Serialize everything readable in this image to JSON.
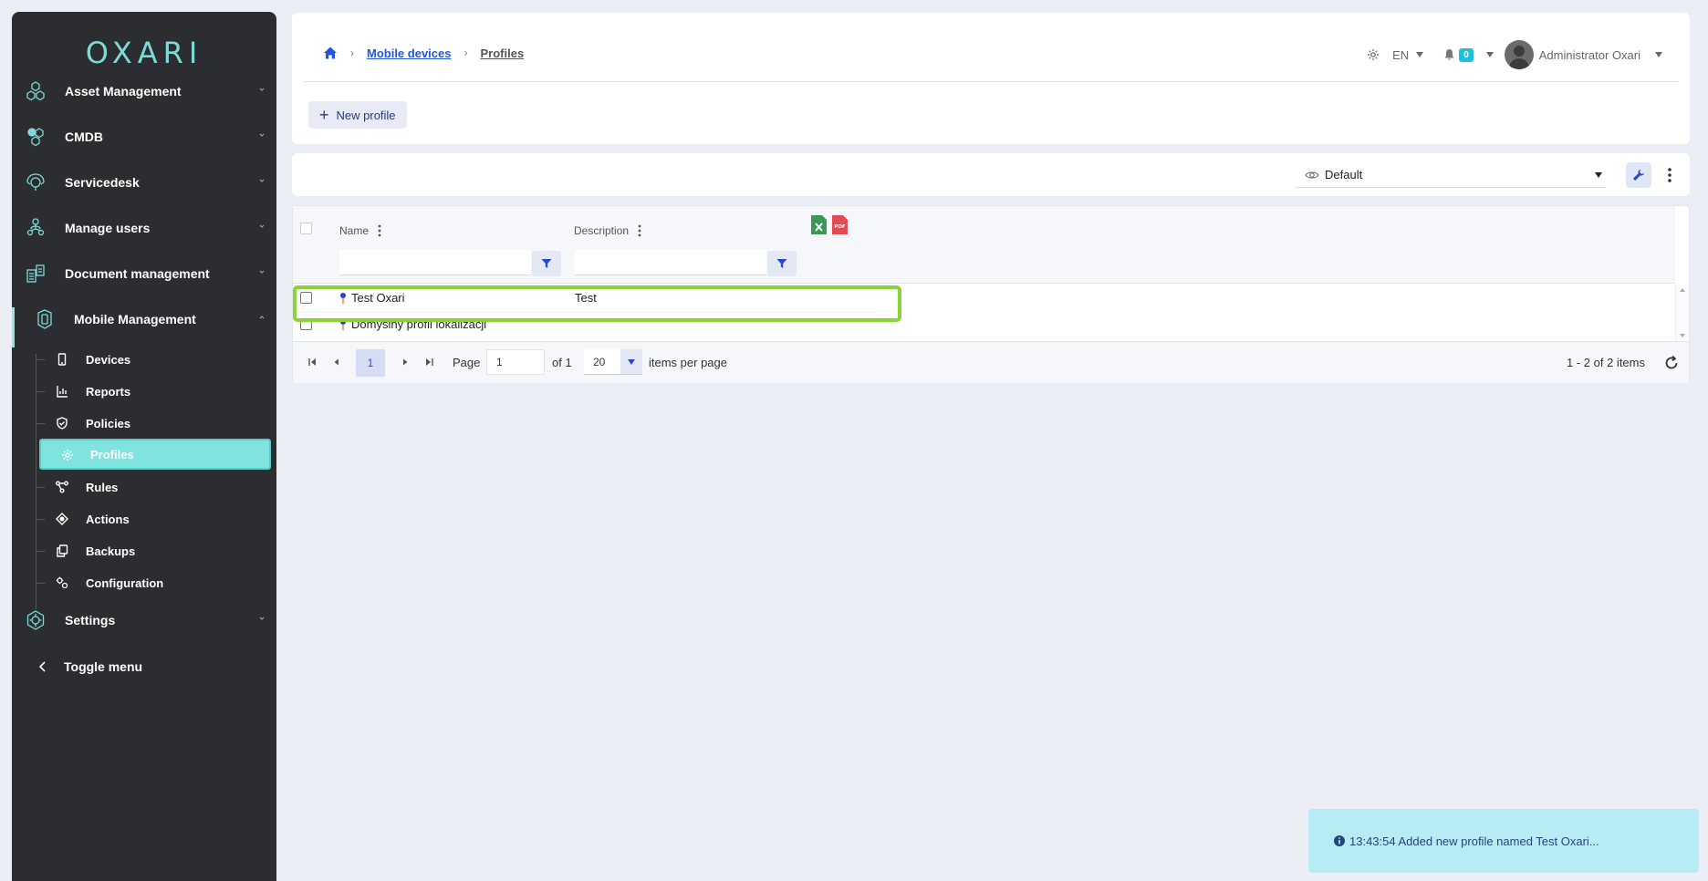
{
  "app": {
    "logo": "OXARI"
  },
  "sidebar": {
    "items": [
      {
        "label": "Asset Management"
      },
      {
        "label": "CMDB"
      },
      {
        "label": "Servicedesk"
      },
      {
        "label": "Manage users"
      },
      {
        "label": "Document management"
      },
      {
        "label": "Mobile Management"
      },
      {
        "label": "Settings"
      }
    ],
    "mobile_sub": [
      {
        "label": "Devices"
      },
      {
        "label": "Reports"
      },
      {
        "label": "Policies"
      },
      {
        "label": "Profiles"
      },
      {
        "label": "Rules"
      },
      {
        "label": "Actions"
      },
      {
        "label": "Backups"
      },
      {
        "label": "Configuration"
      }
    ],
    "toggle_label": "Toggle menu"
  },
  "header": {
    "breadcrumb": {
      "parent": "Mobile devices",
      "current": "Profiles"
    },
    "lang": "EN",
    "notifications": "0",
    "user": "Administrator Oxari",
    "new_button": "New profile"
  },
  "toolbar": {
    "view": "Default"
  },
  "grid": {
    "columns": [
      {
        "label": "Name"
      },
      {
        "label": "Description"
      }
    ],
    "rows": [
      {
        "name": "Test Oxari",
        "description": "Test"
      },
      {
        "name": "Domyślny profil lokalizacji",
        "description": ""
      }
    ],
    "pager": {
      "current": "1",
      "page_label": "Page",
      "page_value": "1",
      "of_label": "of 1",
      "per_page": "20",
      "per_page_label": "items per page",
      "summary": "1 - 2 of 2 items"
    }
  },
  "toast": {
    "message": "13:43:54 Added new profile named Test Oxari..."
  },
  "colors": {
    "accent": "#7fe3df",
    "sidebar": "#2b2d31",
    "link": "#2356d8",
    "highlight": "#8bd33c",
    "toast": "#b8ecf5"
  }
}
